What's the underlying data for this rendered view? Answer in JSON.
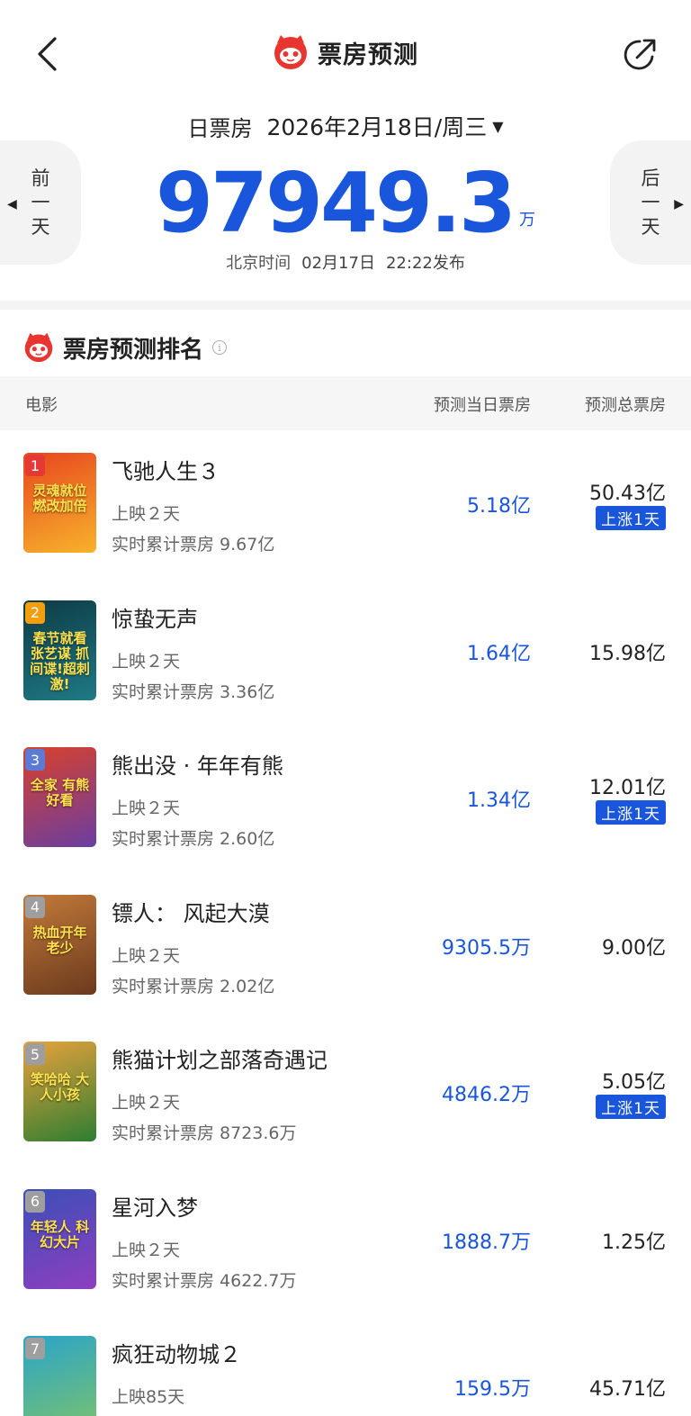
{
  "header": {
    "title": "票房预测",
    "back_icon": "chevron-left-icon",
    "share_icon": "share-icon",
    "logo_icon": "cat-logo-icon"
  },
  "date_selector": {
    "label": "日票房",
    "date": "2026年2月18日/周三",
    "caret": "▼"
  },
  "nav": {
    "prev": {
      "arrow": "◀",
      "chars": [
        "前",
        "一",
        "天"
      ]
    },
    "next": {
      "arrow": "▶",
      "chars": [
        "后",
        "一",
        "天"
      ]
    }
  },
  "summary": {
    "value": "97949.3",
    "unit": "万",
    "publish_prefix": "北京时间",
    "publish_date": "02月17日",
    "publish_time": "22:22发布"
  },
  "section": {
    "title": "票房预测排名",
    "info_icon": "ⓘ"
  },
  "table": {
    "columns": [
      "电影",
      "预测当日票房",
      "预测总票房"
    ],
    "rows": [
      {
        "rank": "1",
        "name": "飞驰人生３",
        "days": "上映２天",
        "cumulative": "实时累计票房 9.67亿",
        "day_bo": "5.18亿",
        "total_bo": "50.43亿",
        "badge": "上涨1天",
        "poster_text": "灵魂就位 燃改加倍",
        "colors": [
          "#e8461f",
          "#f7b32b"
        ],
        "rank_color": "#e53935"
      },
      {
        "rank": "2",
        "name": "惊蛰无声",
        "days": "上映２天",
        "cumulative": "实时累计票房 3.36亿",
        "day_bo": "1.64亿",
        "total_bo": "15.98亿",
        "badge": "",
        "poster_text": "春节就看张艺谋 抓间谍!超刺激!",
        "colors": [
          "#0d3b45",
          "#1f7a86"
        ],
        "rank_color": "#f59e0b"
      },
      {
        "rank": "3",
        "name": "熊出没 · 年年有熊",
        "days": "上映２天",
        "cumulative": "实时累计票房 2.60亿",
        "day_bo": "1.34亿",
        "total_bo": "12.01亿",
        "badge": "上涨1天",
        "poster_text": "全家 有熊 好看",
        "colors": [
          "#d9412b",
          "#6a3ea1"
        ],
        "rank_color": "#5b7bd5"
      },
      {
        "rank": "4",
        "name": "镖人： 风起大漠",
        "days": "上映２天",
        "cumulative": "实时累计票房 2.02亿",
        "day_bo": "9305.5万",
        "total_bo": "9.00亿",
        "badge": "",
        "poster_text": "热血开年 老少",
        "colors": [
          "#c27a3a",
          "#6b3a1d"
        ],
        "rank_color": "#9e9e9e"
      },
      {
        "rank": "5",
        "name": "熊猫计划之部落奇遇记",
        "days": "上映２天",
        "cumulative": "实时累计票房 8723.6万",
        "day_bo": "4846.2万",
        "total_bo": "5.05亿",
        "badge": "上涨1天",
        "poster_text": "笑哈哈 大人小孩",
        "colors": [
          "#e9a23b",
          "#2e7d32"
        ],
        "rank_color": "#9e9e9e"
      },
      {
        "rank": "6",
        "name": "星河入梦",
        "days": "上映２天",
        "cumulative": "实时累计票房 4622.7万",
        "day_bo": "1888.7万",
        "total_bo": "1.25亿",
        "badge": "",
        "poster_text": "年轻人 科幻大片",
        "colors": [
          "#3b4fb8",
          "#8e3fbf"
        ],
        "rank_color": "#9e9e9e"
      },
      {
        "rank": "7",
        "name": "疯狂动物城２",
        "days": "上映85天",
        "cumulative": "",
        "day_bo": "159.5万",
        "total_bo": "45.71亿",
        "badge": "",
        "poster_text": "",
        "colors": [
          "#2aa4c9",
          "#7cc36b"
        ],
        "rank_color": "#9e9e9e"
      }
    ]
  }
}
